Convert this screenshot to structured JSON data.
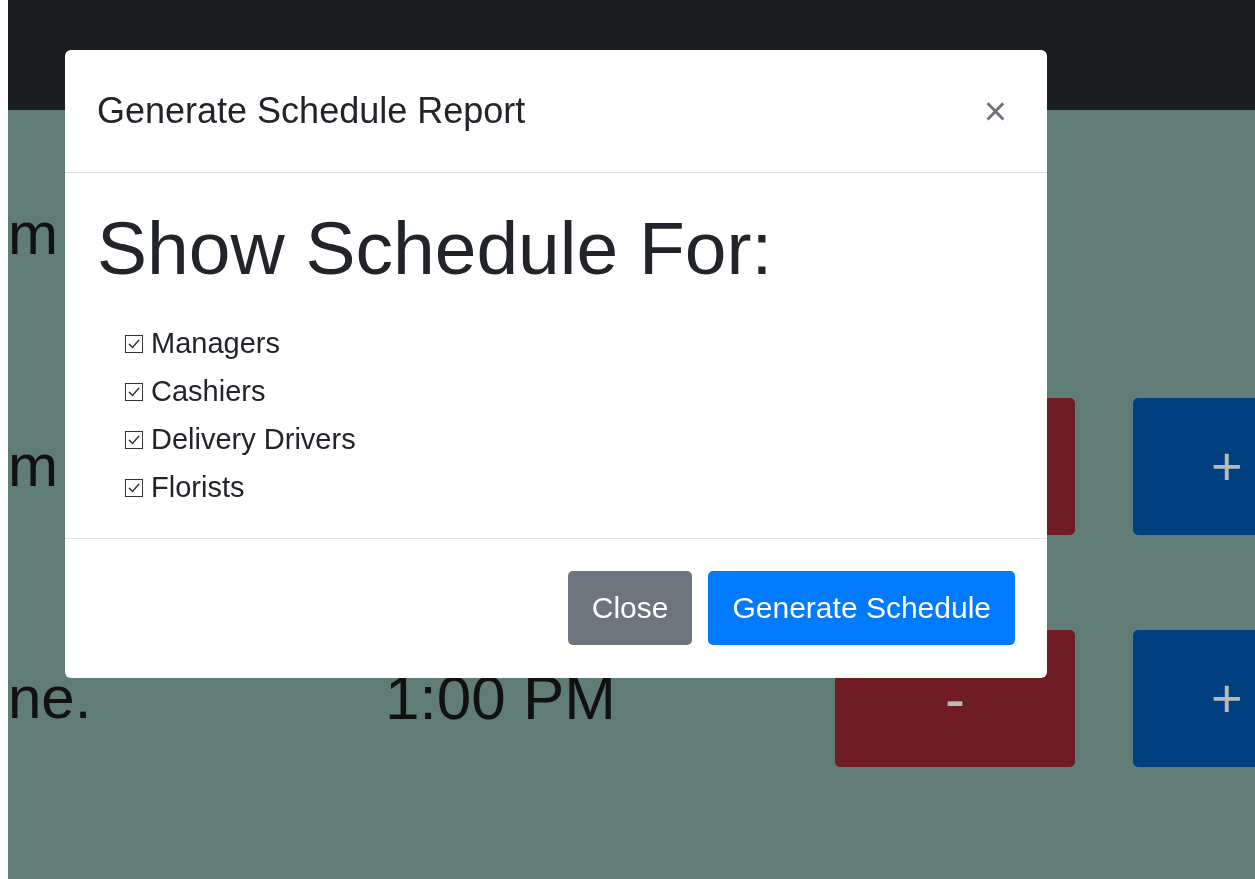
{
  "page": {
    "rows": [
      {
        "label": "m"
      },
      {
        "label": "m",
        "buttons": true,
        "plus": "+"
      },
      {
        "label": "ne.",
        "time": "1:00 PM",
        "buttons": true,
        "minus": "-",
        "plus": "+"
      }
    ]
  },
  "modal": {
    "title": "Generate Schedule Report",
    "close": "×",
    "heading": "Show Schedule For:",
    "options": [
      {
        "label": "Managers",
        "checked": true
      },
      {
        "label": "Cashiers",
        "checked": true
      },
      {
        "label": "Delivery Drivers",
        "checked": true
      },
      {
        "label": "Florists",
        "checked": true
      }
    ],
    "buttons": [
      {
        "label": "Close",
        "kind": "secondary"
      },
      {
        "label": "Generate Schedule",
        "kind": "primary"
      }
    ]
  }
}
